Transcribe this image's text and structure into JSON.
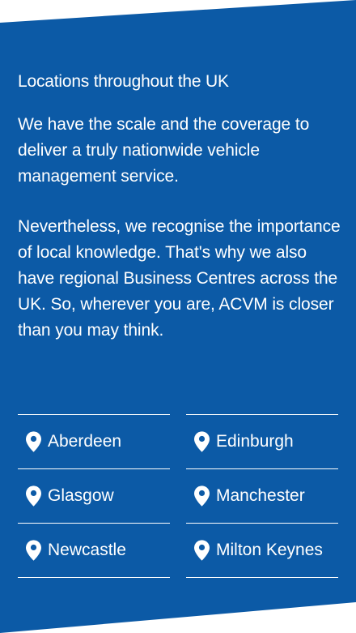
{
  "heading": "Locations throughout the UK",
  "paragraph1": "We have the scale and the coverage to deliver a truly nationwide vehicle management service.",
  "paragraph2": "Nevertheless, we recognise the importance of local knowledge. That's why we also have regional Business Centres across the UK. So, wherever you are, ACVM is closer than you may think.",
  "icon": "map-pin-icon",
  "colors": {
    "panel_bg": "#0c5aa6",
    "text": "#ffffff"
  },
  "locations": [
    {
      "label": "Aberdeen"
    },
    {
      "label": "Edinburgh"
    },
    {
      "label": "Glasgow"
    },
    {
      "label": "Manchester"
    },
    {
      "label": "Newcastle"
    },
    {
      "label": "Milton Keynes"
    }
  ]
}
